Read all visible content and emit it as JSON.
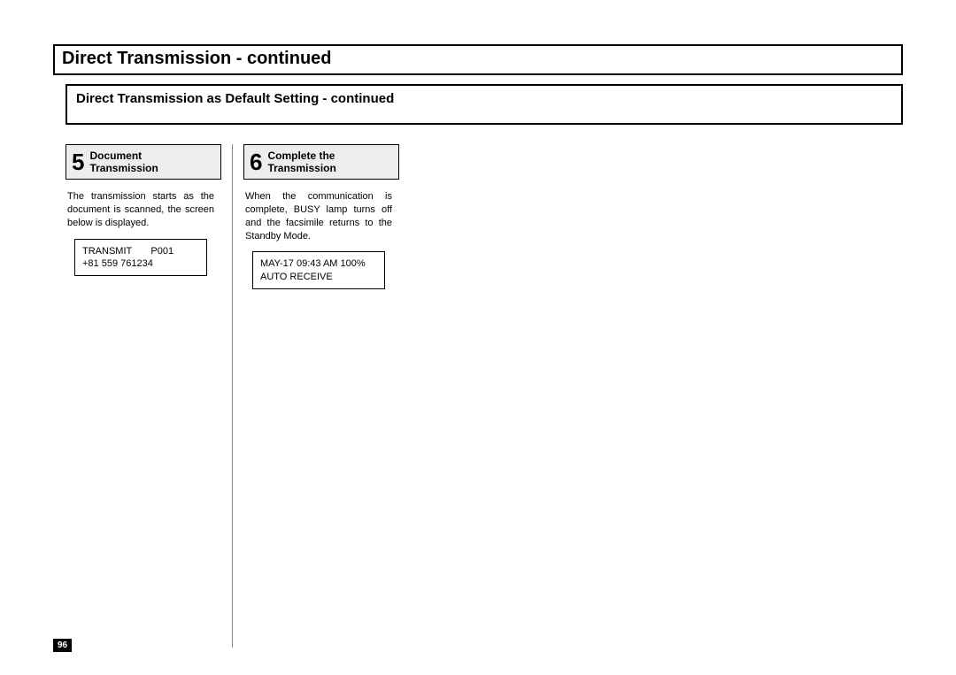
{
  "title": "Direct Transmission - continued",
  "subtitle": "Direct Transmission as Default Setting - continued",
  "step5": {
    "number": "5",
    "title_line1": "Document",
    "title_line2": "Transmission",
    "body": "The transmission starts as the document is scanned, the screen below is displayed.",
    "display_line1": "TRANSMIT       P001",
    "display_line2": "+81 559 761234"
  },
  "step6": {
    "number": "6",
    "title_line1": "Complete the",
    "title_line2": "Transmission",
    "body": "When the communication is complete, BUSY lamp turns off and the facsimile returns to the Standby Mode.",
    "display_line1": "MAY-17 09:43 AM 100%",
    "display_line2": "AUTO RECEIVE"
  },
  "page_number": "96"
}
